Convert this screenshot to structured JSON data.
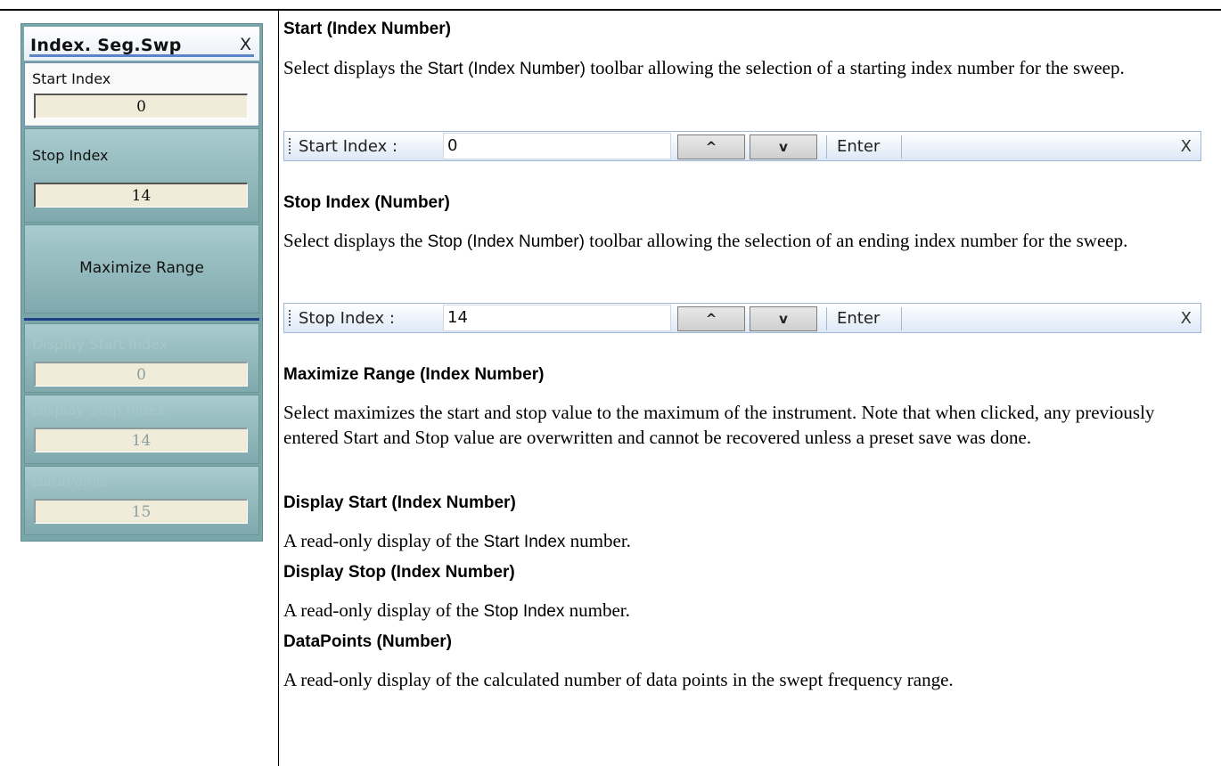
{
  "panel": {
    "title": "Index. Seg.Swp",
    "close": "X",
    "start_index": {
      "label": "Start Index",
      "value": "0"
    },
    "stop_index": {
      "label": "Stop Index",
      "value": "14"
    },
    "maximize": {
      "label": "Maximize Range"
    },
    "display_start": {
      "label": "Display Start Index",
      "value": "0"
    },
    "display_stop": {
      "label": "Display Stop Index",
      "value": "14"
    },
    "datapoints": {
      "label": "DataPoints",
      "value": "15"
    }
  },
  "sections": {
    "start": {
      "heading": "Start (Index Number)",
      "text_a": "Select displays the ",
      "text_b": "Start (Index Number)",
      "text_c": " toolbar allowing the selection of a starting index number for the sweep."
    },
    "stop": {
      "heading": "Stop Index (Number)",
      "text_a": "Select displays the ",
      "text_b": "Stop (Index Number)",
      "text_c": " toolbar allowing the selection of an ending index number for the sweep."
    },
    "maximize": {
      "heading": "Maximize Range (Index Number)",
      "text": "Select maximizes the start and stop value to the maximum of the instrument. Note that when clicked, any previously entered Start and Stop value are overwritten and cannot be recovered unless a preset save was done."
    },
    "display_start": {
      "heading": "Display Start (Index Number)",
      "text_a": "A read-only display of the ",
      "text_b": "Start Index",
      "text_c": " number."
    },
    "display_stop": {
      "heading": "Display Stop (Index Number)",
      "text_a": "A read-only display of the ",
      "text_b": "Stop Index",
      "text_c": " number."
    },
    "datapoints": {
      "heading": "DataPoints (Number)",
      "text": "A read-only display of the calculated number of data points in the swept frequency range."
    }
  },
  "toolbars": {
    "start": {
      "label": "Start Index :",
      "value": "0",
      "up": "^",
      "down": "v",
      "enter": "Enter",
      "close": "X"
    },
    "stop": {
      "label": "Stop Index :",
      "value": "14",
      "up": "^",
      "down": "v",
      "enter": "Enter",
      "close": "X"
    }
  }
}
